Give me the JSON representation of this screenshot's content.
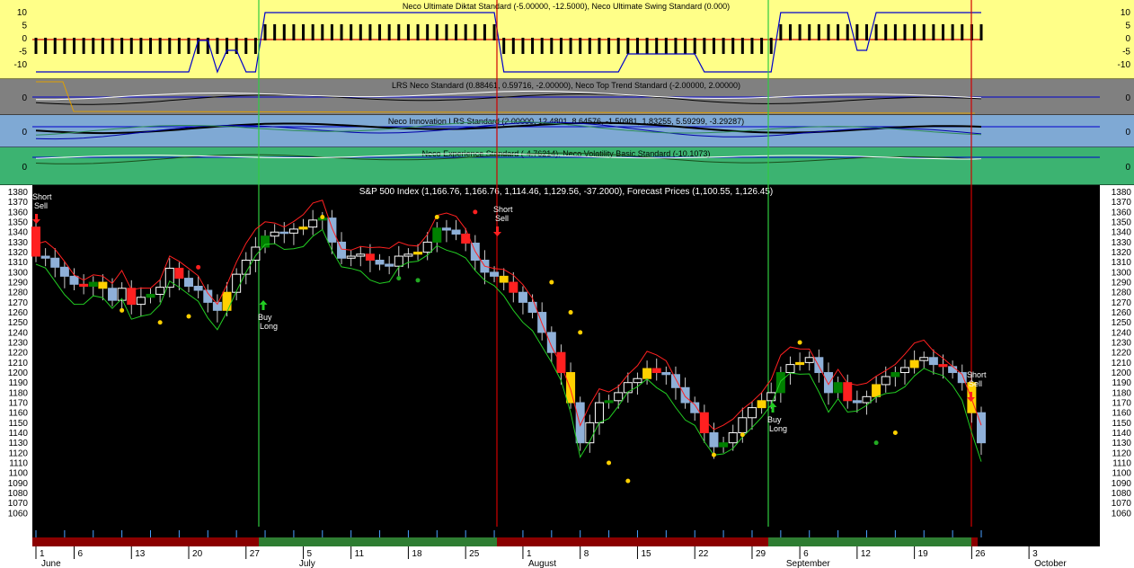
{
  "panels": [
    {
      "id": "p1",
      "title": "Neco Ultimate Diktat Standard (-5.00000, -12.5000), Neco Ultimate Swing Standard (0.000)",
      "bg": "#ffff88",
      "ticks": [
        "10",
        "5",
        "0",
        "-5",
        "-10"
      ]
    },
    {
      "id": "p2",
      "title": "LRS Neco Standard (0.88461, 0.59716, -2.00000), Neco Top Trend Standard (-2.00000, 2.00000)",
      "bg": "#808080",
      "ticks": [
        "0"
      ]
    },
    {
      "id": "p3",
      "title": "Neco Innovation LRS Standard (2.00000, 12.4801, 8.64576, -1.50981, 1.83255, 5.59299, -3.29287)",
      "bg": "#7fa9d4",
      "ticks": [
        "0"
      ]
    },
    {
      "id": "p4",
      "title": "Neco Experience Standard (-4.76214), Neco Volatility Basic Standard (-10.1073)",
      "bg": "#3cb371",
      "ticks": [
        "0"
      ]
    }
  ],
  "main": {
    "title": "S&P 500 Index (1,166.76, 1,166.76, 1,114.46, 1,129.56, -37.2000), Forecast Prices (1,100.55, 1,126.45)"
  },
  "signals": [
    {
      "text1": "Short",
      "text2": "Sell",
      "kind": "short",
      "idx": 0
    },
    {
      "text1": "Short",
      "text2": "Sell",
      "kind": "short",
      "idx": 49
    },
    {
      "text1": "Buy",
      "text2": "Long",
      "kind": "buy",
      "idx": 24
    },
    {
      "text1": "Buy",
      "text2": "Long",
      "kind": "buy",
      "idx": 78
    },
    {
      "text1": "Short",
      "text2": "Sell",
      "kind": "short",
      "idx": 100
    }
  ],
  "date_axis": {
    "days": [
      {
        "t": "1",
        "i": 0
      },
      {
        "t": "6",
        "i": 4
      },
      {
        "t": "13",
        "i": 10
      },
      {
        "t": "20",
        "i": 16
      },
      {
        "t": "27",
        "i": 22
      },
      {
        "t": "5",
        "i": 28
      },
      {
        "t": "11",
        "i": 33
      },
      {
        "t": "18",
        "i": 39
      },
      {
        "t": "25",
        "i": 45
      },
      {
        "t": "1",
        "i": 51
      },
      {
        "t": "8",
        "i": 57
      },
      {
        "t": "15",
        "i": 63
      },
      {
        "t": "22",
        "i": 69
      },
      {
        "t": "29",
        "i": 75
      },
      {
        "t": "6",
        "i": 80
      },
      {
        "t": "12",
        "i": 86
      },
      {
        "t": "19",
        "i": 92
      },
      {
        "t": "26",
        "i": 98
      },
      {
        "t": "3",
        "i": 104
      }
    ],
    "months": [
      {
        "t": "June",
        "i": 0
      },
      {
        "t": "July",
        "i": 27
      },
      {
        "t": "August",
        "i": 51
      },
      {
        "t": "September",
        "i": 78
      },
      {
        "t": "October",
        "i": 104
      }
    ]
  },
  "chart_data": {
    "type": "candlestick",
    "title": "S&P 500 Index (1,166.76, 1,166.76, 1,114.46, 1,129.56, -37.2000), Forecast Prices (1,100.55, 1,126.45)",
    "ylim": [
      1050,
      1385
    ],
    "y_ticks": [
      1380,
      1370,
      1360,
      1350,
      1340,
      1330,
      1320,
      1310,
      1300,
      1290,
      1280,
      1270,
      1260,
      1250,
      1240,
      1230,
      1220,
      1210,
      1200,
      1190,
      1180,
      1170,
      1160,
      1150,
      1140,
      1130,
      1120,
      1110,
      1100,
      1090,
      1080,
      1070,
      1060
    ],
    "close": [
      1316,
      1314,
      1305,
      1296,
      1288,
      1286,
      1290,
      1284,
      1272,
      1284,
      1268,
      1275,
      1278,
      1285,
      1304,
      1294,
      1286,
      1282,
      1270,
      1262,
      1280,
      1298,
      1312,
      1325,
      1336,
      1340,
      1339,
      1343,
      1345,
      1352,
      1354,
      1330,
      1314,
      1316,
      1318,
      1312,
      1308,
      1306,
      1316,
      1318,
      1320,
      1330,
      1344,
      1342,
      1338,
      1329,
      1312,
      1300,
      1296,
      1290,
      1280,
      1270,
      1260,
      1240,
      1220,
      1200,
      1170,
      1130,
      1150,
      1170,
      1172,
      1180,
      1190,
      1194,
      1204,
      1200,
      1198,
      1185,
      1170,
      1160,
      1140,
      1126,
      1130,
      1140,
      1155,
      1165,
      1172,
      1180,
      1200,
      1208,
      1210,
      1215,
      1200,
      1180,
      1190,
      1172,
      1170,
      1176,
      1188,
      1196,
      1200,
      1205,
      1212,
      1215,
      1208,
      1206,
      1200,
      1190,
      1160,
      1130
    ]
  }
}
